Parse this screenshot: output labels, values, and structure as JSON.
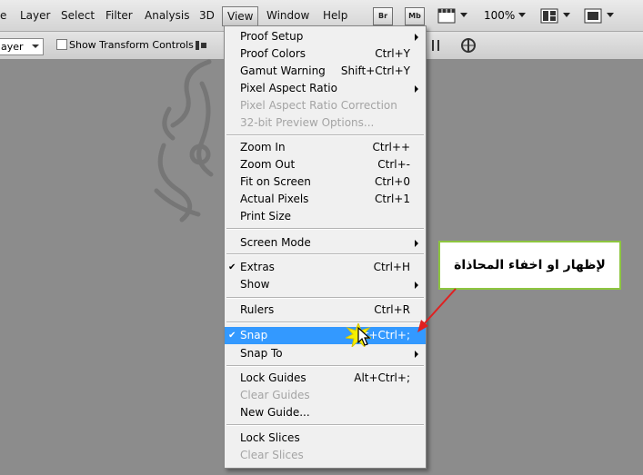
{
  "menubar": {
    "items": [
      "e",
      "Layer",
      "Select",
      "Filter",
      "Analysis",
      "3D",
      "View",
      "Window",
      "Help"
    ],
    "badges": [
      "Br",
      "Mb"
    ],
    "zoom": "100%"
  },
  "options": {
    "layer_select": "ayer",
    "show_transform_label": "Show Transform Controls"
  },
  "view_menu": {
    "g1": [
      {
        "label": "Proof Setup",
        "shortcut": "",
        "submenu": true,
        "disabled": false
      },
      {
        "label": "Proof Colors",
        "shortcut": "Ctrl+Y",
        "submenu": false,
        "disabled": false
      },
      {
        "label": "Gamut Warning",
        "shortcut": "Shift+Ctrl+Y",
        "submenu": false,
        "disabled": false
      },
      {
        "label": "Pixel Aspect Ratio",
        "shortcut": "",
        "submenu": true,
        "disabled": false
      },
      {
        "label": "Pixel Aspect Ratio Correction",
        "shortcut": "",
        "submenu": false,
        "disabled": true
      },
      {
        "label": "32-bit Preview Options...",
        "shortcut": "",
        "submenu": false,
        "disabled": true
      }
    ],
    "g2": [
      {
        "label": "Zoom In",
        "shortcut": "Ctrl++"
      },
      {
        "label": "Zoom Out",
        "shortcut": "Ctrl+-"
      },
      {
        "label": "Fit on Screen",
        "shortcut": "Ctrl+0"
      },
      {
        "label": "Actual Pixels",
        "shortcut": "Ctrl+1"
      },
      {
        "label": "Print Size",
        "shortcut": ""
      }
    ],
    "screen_mode": "Screen Mode",
    "extras": {
      "label": "Extras",
      "shortcut": "Ctrl+H",
      "check": "✔"
    },
    "show": "Show",
    "rulers": {
      "label": "Rulers",
      "shortcut": "Ctrl+R"
    },
    "snap": {
      "label": "Snap",
      "shortcut": "ift+Ctrl+;",
      "check": "✔"
    },
    "snap_to": "Snap To",
    "lock_guides": {
      "label": "Lock Guides",
      "shortcut": "Alt+Ctrl+;"
    },
    "clear_guides": "Clear Guides",
    "new_guide": "New Guide...",
    "lock_slices": "Lock Slices",
    "clear_slices": "Clear Slices"
  },
  "callout": {
    "text": "لإظهار او اخفاء المحاذاة",
    "border_color": "#8dc63f",
    "arrow_color": "#e02020"
  },
  "colors": {
    "highlight": "#3399ff",
    "canvas": "#8c8c8c"
  }
}
